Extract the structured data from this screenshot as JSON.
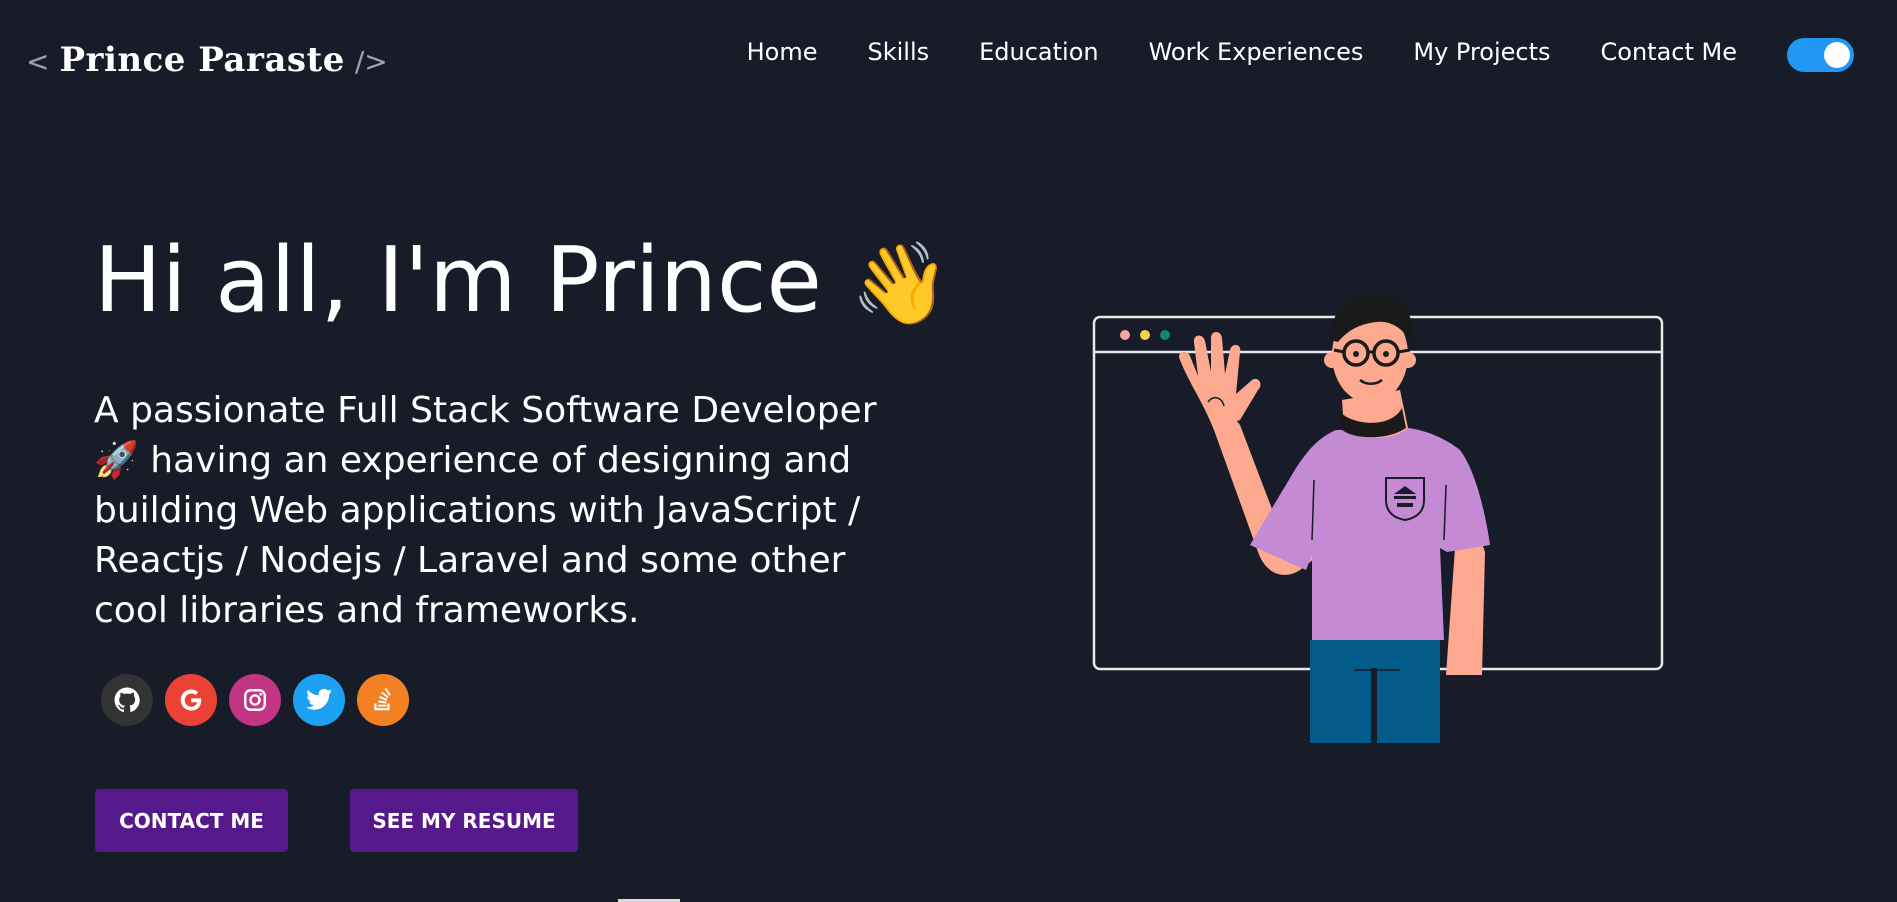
{
  "header": {
    "logo_open": "<",
    "logo_name": "Prince Paraste",
    "logo_close": "/>",
    "nav": [
      {
        "label": "Home"
      },
      {
        "label": "Skills"
      },
      {
        "label": "Education"
      },
      {
        "label": "Work Experiences"
      },
      {
        "label": "My Projects"
      },
      {
        "label": "Contact Me"
      }
    ],
    "theme_toggle": {
      "state": "on",
      "color": "#2196f3"
    }
  },
  "hero": {
    "title": "Hi all, I'm Prince",
    "title_emoji": "👋",
    "subtitle_emoji": "🚀",
    "subtitle": "A passionate Full Stack Software Developer 🚀 having an experience of designing and building Web applications with JavaScript / Reactjs / Nodejs / Laravel and some other cool libraries and frameworks.",
    "social_links": [
      {
        "icon": "github-icon",
        "color": "#333333"
      },
      {
        "icon": "google-icon",
        "color": "#ea4335"
      },
      {
        "icon": "instagram-icon",
        "color": "#c13584"
      },
      {
        "icon": "twitter-icon",
        "color": "#1da1f2"
      },
      {
        "icon": "stackoverflow-icon",
        "color": "#f48024"
      }
    ],
    "buttons": {
      "contact": "CONTACT ME",
      "resume": "SEE MY RESUME"
    }
  },
  "colors": {
    "background": "#171c28",
    "button": "#55198b",
    "text": "#ffffff"
  }
}
